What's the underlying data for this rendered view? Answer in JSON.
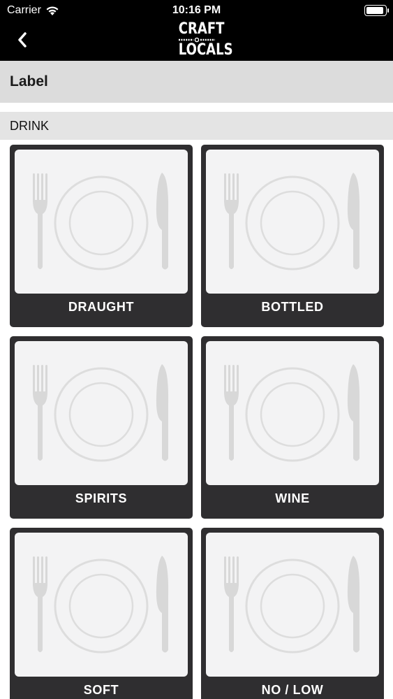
{
  "status_bar": {
    "carrier": "Carrier",
    "time": "10:16 PM"
  },
  "nav": {
    "back_icon": "chevron-left-icon",
    "logo_top": "CRAFT",
    "logo_bottom": "LOCALS"
  },
  "page": {
    "label": "Label"
  },
  "section": {
    "title": "DRINK"
  },
  "categories": [
    {
      "label": "DRAUGHT",
      "icon": "plate-cutlery-icon"
    },
    {
      "label": "BOTTLED",
      "icon": "plate-cutlery-icon"
    },
    {
      "label": "SPIRITS",
      "icon": "plate-cutlery-icon"
    },
    {
      "label": "WINE",
      "icon": "plate-cutlery-icon"
    },
    {
      "label": "SOFT",
      "icon": "plate-cutlery-icon"
    },
    {
      "label": "NO / LOW",
      "icon": "plate-cutlery-icon"
    }
  ],
  "colors": {
    "bar": "#000000",
    "tile": "#2f2e30",
    "header": "#dcdcdc",
    "placeholder": "#f3f3f4"
  }
}
